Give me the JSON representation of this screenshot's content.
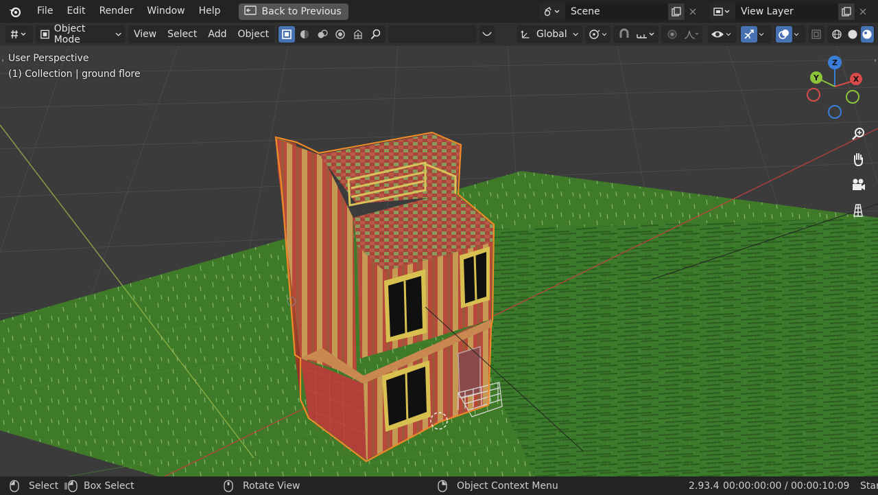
{
  "topbar": {
    "menus": [
      "File",
      "Edit",
      "Render",
      "Window",
      "Help"
    ],
    "back_label": "Back to Previous",
    "scene_name": "Scene",
    "view_layer_name": "View Layer"
  },
  "toolbar": {
    "mode": "Object Mode",
    "menus": [
      "View",
      "Select",
      "Add",
      "Object"
    ],
    "transform_orientation": "Global"
  },
  "viewport": {
    "perspective": "User Perspective",
    "collection": "(1) Collection | ground flore"
  },
  "gizmo": {
    "z": "Z",
    "y": "Y",
    "x": "X"
  },
  "statusbar": {
    "select": "Select",
    "box_select": "Box Select",
    "rotate": "Rotate View",
    "context_menu": "Object Context Menu",
    "version": "2.93.4",
    "timecode": "00:00:00:00 / 00:00:10:09",
    "truncated": "Star"
  },
  "colors": {
    "accent": "#4772b3",
    "selection_outline": "#f0882a",
    "ground": "#3f7a26",
    "x_axis": "#d94b4b",
    "y_axis": "#8cc43a",
    "z_axis": "#3a7ed9"
  }
}
